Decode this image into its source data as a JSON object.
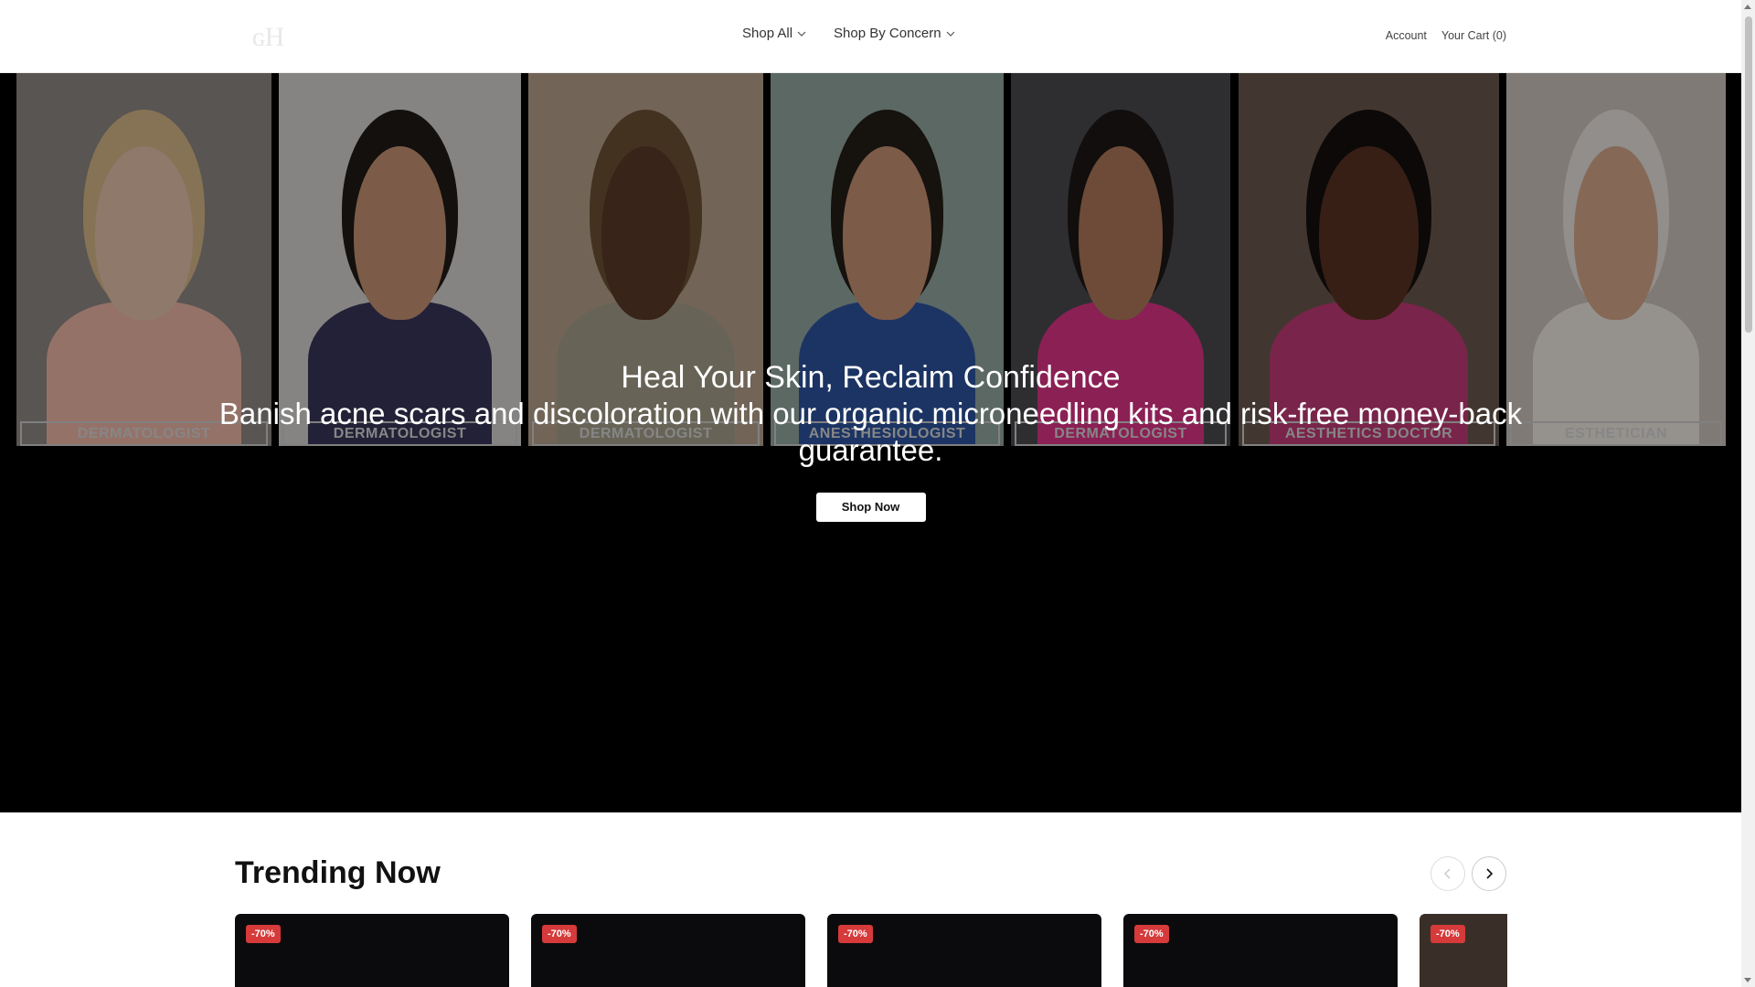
{
  "header": {
    "nav": [
      {
        "label": "Shop All"
      },
      {
        "label": "Shop By Concern"
      }
    ],
    "account_label": "Account",
    "cart_label": "Your Cart (0)"
  },
  "hero": {
    "panels": [
      {
        "tag": "DERMATOLOGIST",
        "bg": "#8e8a86",
        "skin": "#e7c3ad",
        "top": "#f0b8a8",
        "hair": "#d9b98a"
      },
      {
        "tag": "DERMATOLOGIST",
        "bg": "#d8d6d4",
        "skin": "#c89575",
        "top": "#38365a",
        "hair": "#1f1a17"
      },
      {
        "tag": "DERMATOLOGIST",
        "bg": "#b9a48f",
        "skin": "#5b3a28",
        "top": "#a7a28d",
        "hair": "#6e5236"
      },
      {
        "tag": "ANESTHESIOLOGIST",
        "bg": "#93a9a2",
        "skin": "#c99474",
        "top": "#2e55a0",
        "hair": "#241d18"
      },
      {
        "tag": "DERMATOLOGIST",
        "bg": "#4b4b4f",
        "skin": "#b07a5b",
        "top": "#e0348a",
        "hair": "#1c1716"
      },
      {
        "tag": "AESTHETICS DOCTOR",
        "bg": "#6b5a4e",
        "skin": "#5a3322",
        "top": "#c33a78",
        "hair": "#14100e"
      },
      {
        "tag": "ESTHETICIAN",
        "bg": "#cfc6bf",
        "skin": "#d9a88d",
        "top": "#f1ece6",
        "hair": "#ebe6e0"
      }
    ],
    "title": "Heal Your Skin, Reclaim Confidence",
    "subtitle": "Banish acne scars and discoloration with our organic microneedling kits and risk-free money-back guarantee.",
    "cta_label": "Shop Now"
  },
  "trending": {
    "title": "Trending Now",
    "cards": [
      {
        "badge": "-70%"
      },
      {
        "badge": "-70%"
      },
      {
        "badge": "-70%"
      },
      {
        "badge": "-70%"
      },
      {
        "badge": "-70%"
      }
    ]
  },
  "colors": {
    "badge": "#d63a3a",
    "hero_bg": "#000000"
  },
  "icons": [
    "logo-icon",
    "chevron-down-icon",
    "chevron-left-icon",
    "chevron-right-icon"
  ]
}
